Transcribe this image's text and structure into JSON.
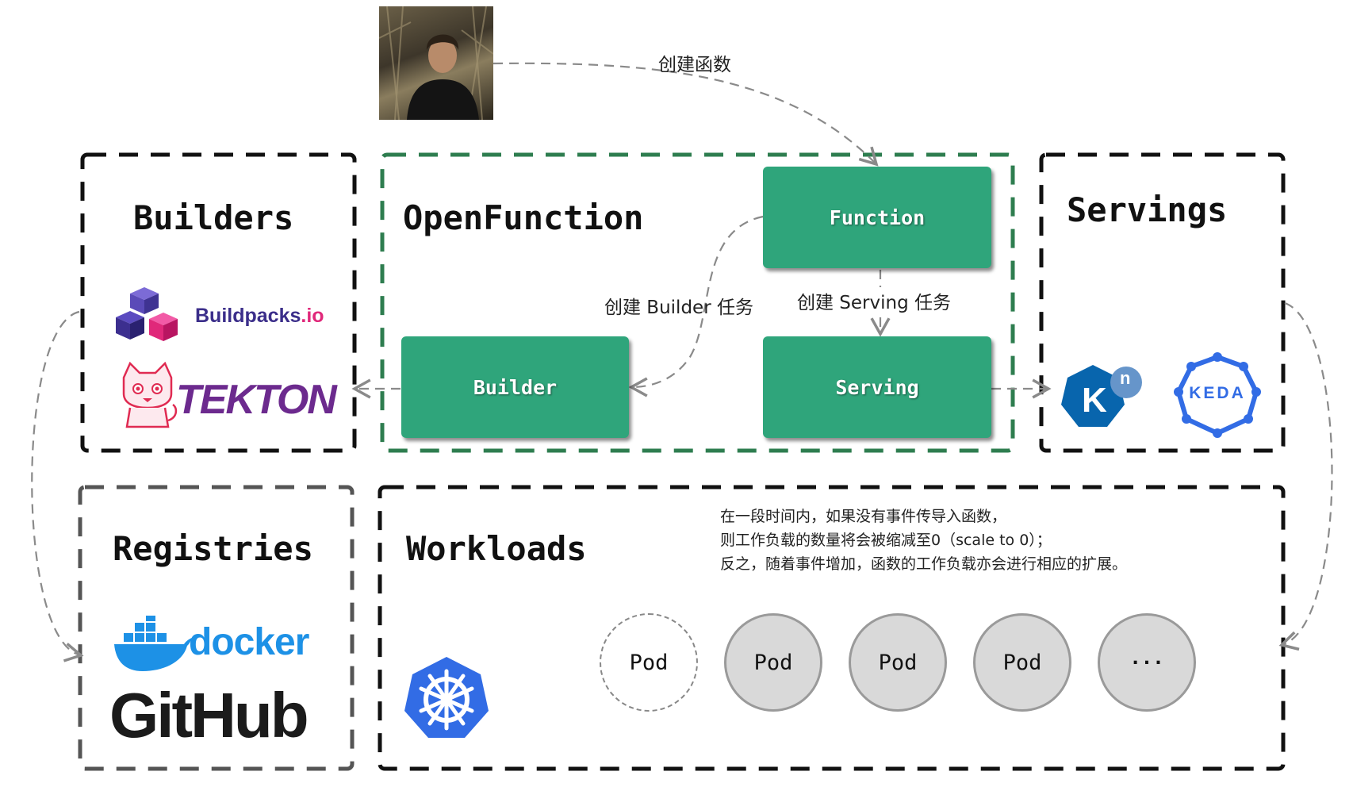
{
  "actor": {
    "caption": "创建函数"
  },
  "groups": {
    "builders": {
      "title": "Builders"
    },
    "openfunction": {
      "title": "OpenFunction"
    },
    "servings": {
      "title": "Servings"
    },
    "registries": {
      "title": "Registries"
    },
    "workloads": {
      "title": "Workloads"
    }
  },
  "nodes": {
    "function": "Function",
    "builder": "Builder",
    "serving": "Serving"
  },
  "edge_labels": {
    "create_builder": "创建 Builder 任务",
    "create_serving": "创建 Serving 任务"
  },
  "logos": {
    "buildpacks": {
      "text_main": "Buildpacks",
      "text_suffix": ".io"
    },
    "tekton": "TEKTON",
    "knative": {
      "letter": "K",
      "badge": "n"
    },
    "keda": "KEDA",
    "docker": "docker",
    "github": "GitHub"
  },
  "workloads_note": [
    "在一段时间内，如果没有事件传导入函数，",
    "则工作负载的数量将会被缩减至0（scale to 0）；",
    "反之，随着事件增加，函数的工作负载亦会进行相应的扩展。"
  ],
  "pods": [
    "Pod",
    "Pod",
    "Pod",
    "Pod",
    "···"
  ],
  "colors": {
    "node_green": "#2fa57b",
    "openfunction_border": "#2e7d4f",
    "black_border": "#111111",
    "arrow_gray": "#8a8a8a",
    "tekton_purple": "#6c2a8e",
    "docker_blue": "#1d91e6",
    "kubernetes_blue": "#326ce5",
    "knative_blue": "#0865ad",
    "keda_blue": "#326ce5"
  }
}
